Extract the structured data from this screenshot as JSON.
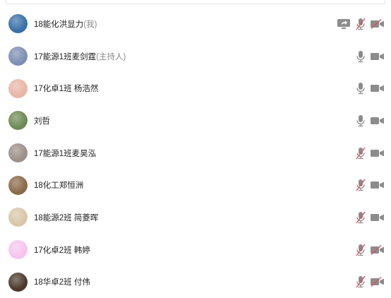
{
  "participants": [
    {
      "name": "18能化洪显力",
      "suffix": "(我)",
      "screen_share": true,
      "mic": "muted",
      "cam": "off",
      "avatar_color": "#3a6fa8"
    },
    {
      "name": "17能源1班麦剑霆",
      "suffix": "(主持人)",
      "screen_share": false,
      "mic": "on",
      "cam": "on",
      "avatar_color": "#7d8fb3"
    },
    {
      "name": "17化卓1班 杨浩然",
      "suffix": "",
      "screen_share": false,
      "mic": "on",
      "cam": "on",
      "avatar_color": "#e8b6a6"
    },
    {
      "name": "刘哲",
      "suffix": "",
      "screen_share": false,
      "mic": "on",
      "cam": "on",
      "avatar_color": "#6e8a55"
    },
    {
      "name": "17能源1班麦昊泓",
      "suffix": "",
      "screen_share": false,
      "mic": "muted",
      "cam": "on",
      "avatar_color": "#9c9088"
    },
    {
      "name": "18化工郑恒洲",
      "suffix": "",
      "screen_share": false,
      "mic": "muted",
      "cam": "on",
      "avatar_color": "#8a6a4a"
    },
    {
      "name": "18能源2班 简菱晖",
      "suffix": "",
      "screen_share": false,
      "mic": "muted",
      "cam": "on",
      "avatar_color": "#d8c7a8"
    },
    {
      "name": "17化卓2班 韩婷",
      "suffix": "",
      "screen_share": false,
      "mic": "muted",
      "cam": "off",
      "avatar_color": "#f6c4ee"
    },
    {
      "name": "18华卓2班 付伟",
      "suffix": "",
      "screen_share": false,
      "mic": "muted",
      "cam": "off",
      "avatar_color": "#4b3a2c"
    }
  ],
  "colors": {
    "icon": "#8c8c8c",
    "muted": "#e0525a"
  }
}
